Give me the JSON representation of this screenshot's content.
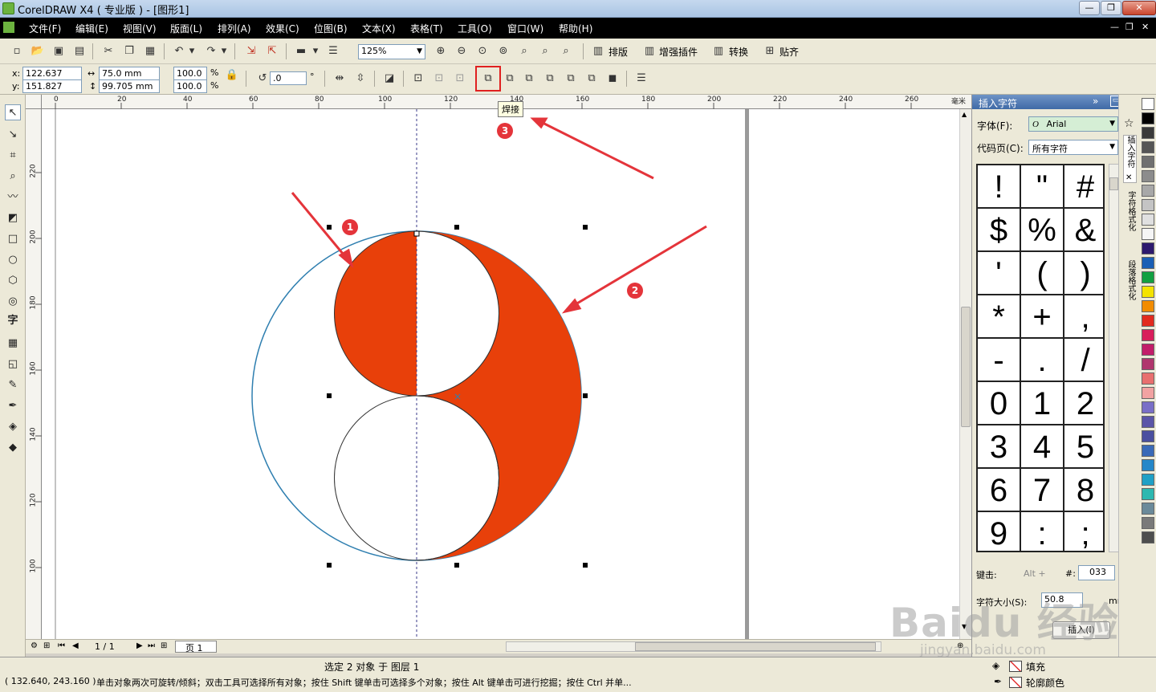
{
  "window": {
    "title": "CorelDRAW X4 ( 专业版 ) - [图形1]",
    "minimize": "—",
    "maximize": "❐",
    "close": "✕"
  },
  "menu": {
    "items": [
      "文件(F)",
      "编辑(E)",
      "视图(V)",
      "版面(L)",
      "排列(A)",
      "效果(C)",
      "位图(B)",
      "文本(X)",
      "表格(T)",
      "工具(O)",
      "窗口(W)",
      "帮助(H)"
    ],
    "mdi_min": "—",
    "mdi_restore": "❐",
    "mdi_close": "✕"
  },
  "standard_toolbar": {
    "zoom_value": "125%",
    "plugin_buttons": [
      "排版",
      "增强插件",
      "转换",
      "贴齐"
    ]
  },
  "property_bar": {
    "x_label": "x:",
    "x_value": "122.637 mm",
    "y_label": "y:",
    "y_value": "151.827 mm",
    "width_value": "75.0 mm",
    "height_value": "99.705 mm",
    "scale_x": "100.0",
    "scale_y": "100.0",
    "percent": "%",
    "rotation_value": ".0",
    "degree": "°",
    "weld_tooltip": "焊接"
  },
  "ruler": {
    "h_labels": [
      "0",
      "20",
      "40",
      "60",
      "80",
      "100",
      "120",
      "140",
      "160",
      "180",
      "200",
      "220",
      "240",
      "260"
    ],
    "v_labels": [
      "220",
      "200",
      "180",
      "160",
      "140",
      "120",
      "100"
    ],
    "unit": "毫米"
  },
  "annotations": {
    "badges": [
      "1",
      "2",
      "3"
    ],
    "accent": "#e4343a",
    "fill_color": "#e8400a"
  },
  "page_nav": {
    "page_count": "1 / 1",
    "page_tab": "页 1"
  },
  "docker": {
    "title": "插入字符",
    "font_label": "字体(F):",
    "font_value": "Arial",
    "codepage_label": "代码页(C):",
    "codepage_value": "所有字符",
    "glyphs": [
      "!",
      "\"",
      "#",
      "$",
      "%",
      "&",
      "'",
      "(",
      ")",
      "*",
      "+",
      ",",
      "-",
      ".",
      "/",
      "0",
      "1",
      "2",
      "3",
      "4",
      "5",
      "6",
      "7",
      "8",
      "9",
      ":",
      ";"
    ],
    "keystroke_label": "键击:",
    "alt_label": "Alt +",
    "hash_label": "#:",
    "code_value": "033",
    "size_label": "字符大小(S):",
    "size_value": "50.8",
    "size_unit": "mm",
    "insert_button": "插入(I)",
    "side_tabs": [
      "插入字符",
      "字符格式化",
      "段落格式化"
    ]
  },
  "status": {
    "selection": "选定 2 对象 于 图层 1",
    "coords": "( 132.640, 243.160 )",
    "hint": "单击对象两次可旋转/倾斜；双击工具可选择所有对象；按住 Shift 键单击可选择多个对象；按住 Alt 键单击可进行挖掘；按住 Ctrl 并单...",
    "fill_label": "填充",
    "outline_label": "轮廓颜色"
  },
  "watermark": {
    "brand": "Baidu 经验",
    "url": "jingyan.baidu.com"
  },
  "palette_colors": [
    "#ffffff",
    "#000000",
    "#3a3a3a",
    "#555555",
    "#707070",
    "#8c8c8c",
    "#a8a8a8",
    "#c4c4c4",
    "#e0e0e0",
    "#f5f5f5",
    "#2e1a6e",
    "#1b5fb5",
    "#12a040",
    "#f4e300",
    "#f28c00",
    "#e22b1f",
    "#d81e5b",
    "#c21d6a",
    "#b0366e",
    "#e86f6f",
    "#f2a2a2",
    "#7a6fc7",
    "#5b55a8",
    "#4a4fa0",
    "#3a6ab8",
    "#2587c9",
    "#20a0c6",
    "#2db8b0",
    "#6b8a9a",
    "#7a7a7a",
    "#4e4e4e"
  ]
}
